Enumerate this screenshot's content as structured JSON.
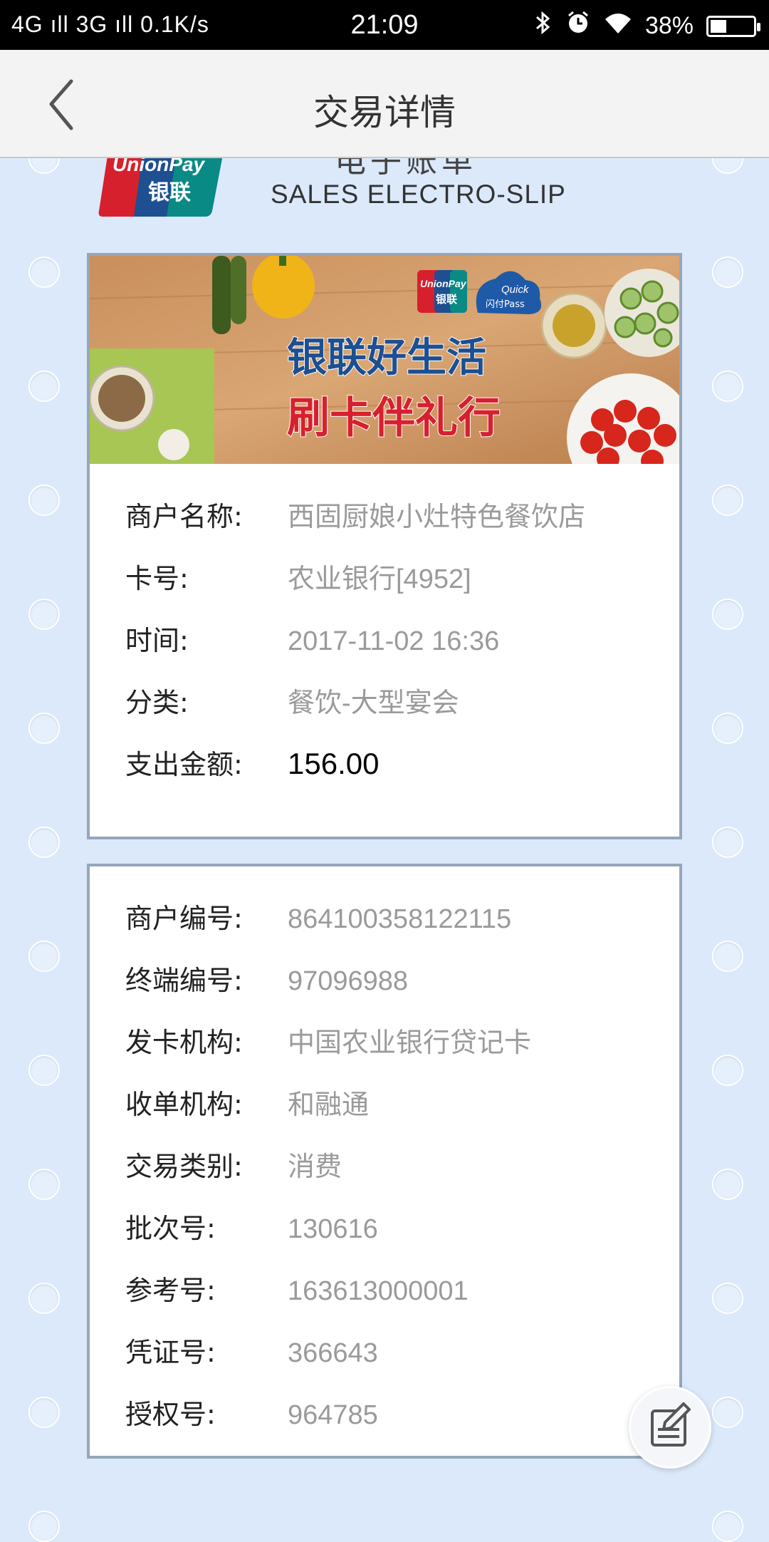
{
  "status_bar": {
    "network": "4G ıll 3G ıll 0.1K/s",
    "time": "21:09",
    "battery": "38%",
    "battery_level": 0.38,
    "icons": [
      "bluetooth-icon",
      "alarm-icon",
      "wifi-icon",
      "battery-icon"
    ]
  },
  "nav": {
    "title": "交易详情",
    "back_icon": "chevron-left-icon"
  },
  "slip_header": {
    "logo_text_en": "UnionPay",
    "logo_text_cn": "银联",
    "title_cn": "电子账单",
    "subtitle": "SALES  ELECTRO-SLIP"
  },
  "banner": {
    "headline_1": "银联好生活",
    "headline_2": "刷卡伴礼行",
    "badge_unionpay_en": "UnionPay",
    "badge_unionpay_cn": "银联",
    "badge_quickpass_en": "Quick",
    "badge_quickpass_cn": "闪付Pass"
  },
  "summary": {
    "rows": [
      {
        "label": "商户名称:",
        "value": "西固厨娘小灶特色餐饮店"
      },
      {
        "label": "卡号:",
        "value": "农业银行[4952]"
      },
      {
        "label": "时间:",
        "value": "2017-11-02 16:36"
      },
      {
        "label": "分类:",
        "value": "餐饮-大型宴会"
      },
      {
        "label": "支出金额:",
        "value": "156.00"
      }
    ]
  },
  "details": {
    "rows": [
      {
        "label": "商户编号:",
        "value": "864100358122115"
      },
      {
        "label": "终端编号:",
        "value": "97096988"
      },
      {
        "label": "发卡机构:",
        "value": "中国农业银行贷记卡"
      },
      {
        "label": "收单机构:",
        "value": "和融通"
      },
      {
        "label": "交易类别:",
        "value": "消费"
      },
      {
        "label": "批次号:",
        "value": "130616"
      },
      {
        "label": "参考号:",
        "value": "163613000001"
      },
      {
        "label": "凭证号:",
        "value": "366643"
      },
      {
        "label": "授权号:",
        "value": "964785"
      }
    ]
  },
  "fab": {
    "icon": "edit-note-icon"
  },
  "colors": {
    "background": "#dbe9fb",
    "card_border": "#96a6ba",
    "unionpay_red": "#d7202e",
    "unionpay_blue": "#1d4f91",
    "unionpay_teal": "#0a8a85"
  }
}
